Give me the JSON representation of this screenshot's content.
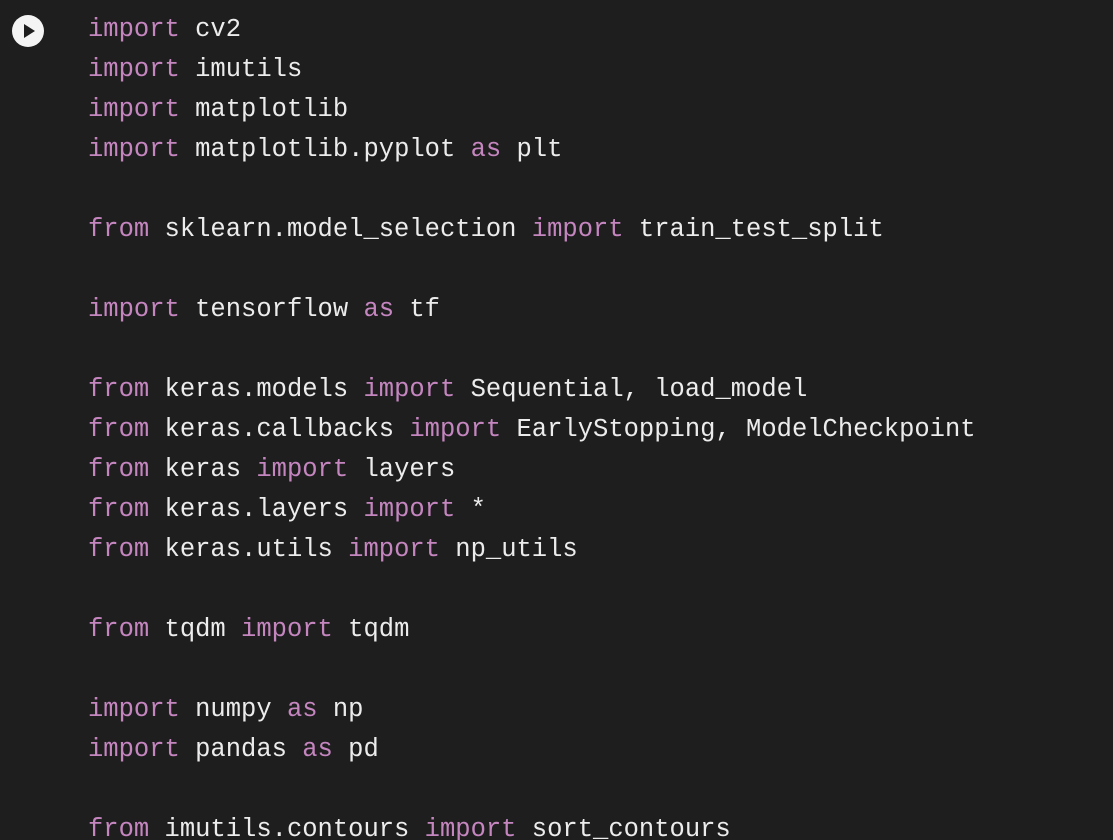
{
  "run_button": {
    "icon": "play-icon"
  },
  "colors": {
    "background": "#1e1e1e",
    "keyword": "#c586c0",
    "text": "#ececec",
    "run_button_bg": "#f4f4f4"
  },
  "code_lines": [
    [
      {
        "t": "kw",
        "v": "import"
      },
      {
        "t": "tx",
        "v": " cv2"
      }
    ],
    [
      {
        "t": "kw",
        "v": "import"
      },
      {
        "t": "tx",
        "v": " imutils"
      }
    ],
    [
      {
        "t": "kw",
        "v": "import"
      },
      {
        "t": "tx",
        "v": " matplotlib"
      }
    ],
    [
      {
        "t": "kw",
        "v": "import"
      },
      {
        "t": "tx",
        "v": " matplotlib.pyplot "
      },
      {
        "t": "kw",
        "v": "as"
      },
      {
        "t": "tx",
        "v": " plt"
      }
    ],
    [],
    [
      {
        "t": "kw",
        "v": "from"
      },
      {
        "t": "tx",
        "v": " sklearn.model_selection "
      },
      {
        "t": "kw",
        "v": "import"
      },
      {
        "t": "tx",
        "v": " train_test_split"
      }
    ],
    [],
    [
      {
        "t": "kw",
        "v": "import"
      },
      {
        "t": "tx",
        "v": " tensorflow "
      },
      {
        "t": "kw",
        "v": "as"
      },
      {
        "t": "tx",
        "v": " tf"
      }
    ],
    [],
    [
      {
        "t": "kw",
        "v": "from"
      },
      {
        "t": "tx",
        "v": " keras.models "
      },
      {
        "t": "kw",
        "v": "import"
      },
      {
        "t": "tx",
        "v": " Sequential, load_model"
      }
    ],
    [
      {
        "t": "kw",
        "v": "from"
      },
      {
        "t": "tx",
        "v": " keras.callbacks "
      },
      {
        "t": "kw",
        "v": "import"
      },
      {
        "t": "tx",
        "v": " EarlyStopping, ModelCheckpoint"
      }
    ],
    [
      {
        "t": "kw",
        "v": "from"
      },
      {
        "t": "tx",
        "v": " keras "
      },
      {
        "t": "kw",
        "v": "import"
      },
      {
        "t": "tx",
        "v": " layers"
      }
    ],
    [
      {
        "t": "kw",
        "v": "from"
      },
      {
        "t": "tx",
        "v": " keras.layers "
      },
      {
        "t": "kw",
        "v": "import"
      },
      {
        "t": "tx",
        "v": " *"
      }
    ],
    [
      {
        "t": "kw",
        "v": "from"
      },
      {
        "t": "tx",
        "v": " keras.utils "
      },
      {
        "t": "kw",
        "v": "import"
      },
      {
        "t": "tx",
        "v": " np_utils"
      }
    ],
    [],
    [
      {
        "t": "kw",
        "v": "from"
      },
      {
        "t": "tx",
        "v": " tqdm "
      },
      {
        "t": "kw",
        "v": "import"
      },
      {
        "t": "tx",
        "v": " tqdm"
      }
    ],
    [],
    [
      {
        "t": "kw",
        "v": "import"
      },
      {
        "t": "tx",
        "v": " numpy "
      },
      {
        "t": "kw",
        "v": "as"
      },
      {
        "t": "tx",
        "v": " np"
      }
    ],
    [
      {
        "t": "kw",
        "v": "import"
      },
      {
        "t": "tx",
        "v": " pandas "
      },
      {
        "t": "kw",
        "v": "as"
      },
      {
        "t": "tx",
        "v": " pd"
      }
    ],
    [],
    [
      {
        "t": "kw",
        "v": "from"
      },
      {
        "t": "tx",
        "v": " imutils.contours "
      },
      {
        "t": "kw",
        "v": "import"
      },
      {
        "t": "tx",
        "v": " sort_contours"
      }
    ]
  ]
}
